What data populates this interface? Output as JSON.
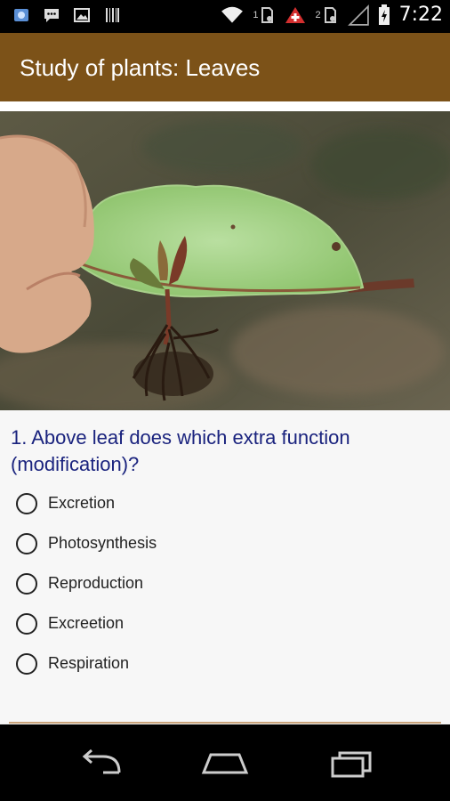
{
  "status_bar": {
    "time": "7:22",
    "notification_icons": [
      "drive-icon",
      "chat-icon",
      "image-icon",
      "barcode-icon"
    ],
    "status_icons": [
      "wifi-icon",
      "sim1-icon",
      "alert-icon",
      "sim2-icon",
      "signal-icon",
      "battery-icon"
    ],
    "sim1_label": "1",
    "sim2_label": "2"
  },
  "action_bar": {
    "title": "Study of plants: Leaves"
  },
  "question": {
    "text": "1. Above leaf does which extra function (modification)?",
    "options": [
      {
        "label": "Excretion"
      },
      {
        "label": "Photosynthesis"
      },
      {
        "label": "Reproduction"
      },
      {
        "label": "Excreetion"
      },
      {
        "label": "Respiration"
      }
    ]
  },
  "colors": {
    "action_bar": "#7c5218",
    "question_text": "#1a237e"
  },
  "nav_bar": {
    "buttons": [
      "back-icon",
      "home-icon",
      "recents-icon"
    ]
  }
}
